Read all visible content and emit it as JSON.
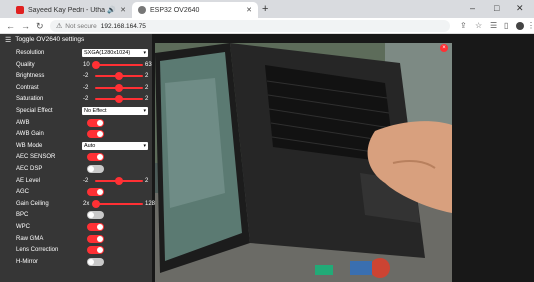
{
  "browser": {
    "tabs": [
      {
        "title": "Sayeed Kay Pedri - Utha Us...",
        "active": false,
        "favicon_color": "#e02020"
      },
      {
        "title": "ESP32 OV2640",
        "active": true,
        "favicon_color": "#555555"
      }
    ],
    "new_tab": "+",
    "window_controls": {
      "minimize": "‒",
      "maximize": "□",
      "close": "✕"
    },
    "address": {
      "security_warning": "Not secure",
      "url": "192.168.164.75"
    }
  },
  "sidebar": {
    "toggle_label": "Toggle OV2640 settings",
    "controls": [
      {
        "label": "Resolution",
        "kind": "select",
        "value": "SXGA(1280x1024)"
      },
      {
        "label": "Quality",
        "kind": "slider",
        "min": "10",
        "max": "63",
        "value": 0.03
      },
      {
        "label": "Brightness",
        "kind": "slider",
        "min": "-2",
        "max": "2",
        "value": 0.5
      },
      {
        "label": "Contrast",
        "kind": "slider",
        "min": "-2",
        "max": "2",
        "value": 0.5
      },
      {
        "label": "Saturation",
        "kind": "slider",
        "min": "-2",
        "max": "2",
        "value": 0.5
      },
      {
        "label": "Special Effect",
        "kind": "select",
        "value": "No Effect"
      },
      {
        "label": "AWB",
        "kind": "toggle",
        "on": true
      },
      {
        "label": "AWB Gain",
        "kind": "toggle",
        "on": true
      },
      {
        "label": "WB Mode",
        "kind": "select",
        "value": "Auto"
      },
      {
        "label": "AEC SENSOR",
        "kind": "toggle",
        "on": true
      },
      {
        "label": "AEC DSP",
        "kind": "toggle",
        "on": false
      },
      {
        "label": "AE Level",
        "kind": "slider",
        "min": "-2",
        "max": "2",
        "value": 0.5
      },
      {
        "label": "AGC",
        "kind": "toggle",
        "on": true
      },
      {
        "label": "Gain Ceiling",
        "kind": "slider",
        "min": "2x",
        "max": "128x",
        "value": 0.03
      },
      {
        "label": "BPC",
        "kind": "toggle",
        "on": false
      },
      {
        "label": "WPC",
        "kind": "toggle",
        "on": true
      },
      {
        "label": "Raw GMA",
        "kind": "toggle",
        "on": true
      },
      {
        "label": "Lens Correction",
        "kind": "toggle",
        "on": true
      },
      {
        "label": "H-Mirror",
        "kind": "toggle",
        "on": false
      }
    ]
  },
  "stream": {
    "close_label": "×"
  },
  "colors": {
    "accent": "#ff3034",
    "sidebar_bg": "#363636",
    "page_bg": "#181818",
    "toggle_off": "#c9c9c9"
  }
}
